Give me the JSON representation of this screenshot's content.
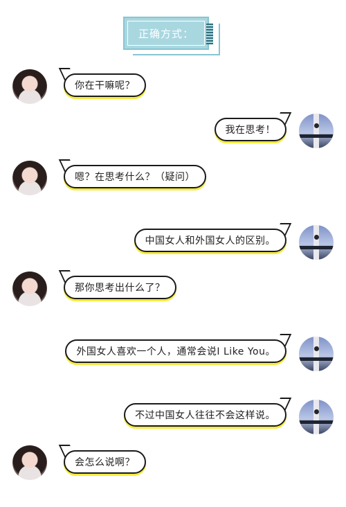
{
  "title": "正确方式：",
  "messages": [
    {
      "side": "left",
      "text": "你在干嘛呢？"
    },
    {
      "side": "right",
      "text": "我在思考！"
    },
    {
      "side": "left",
      "text": "嗯？在思考什么？（疑问）"
    },
    {
      "side": "right",
      "text": "中国女人和外国女人的区别。"
    },
    {
      "side": "left",
      "text": "那你思考出什么了？"
    },
    {
      "side": "right",
      "text": "外国女人喜欢一个人，通常会说I Like You。"
    },
    {
      "side": "right",
      "text": "不过中国女人往往不会这样说。"
    },
    {
      "side": "left",
      "text": "会怎么说啊？"
    }
  ],
  "colors": {
    "title_bg": "#a9d7e0",
    "bubble_underline": "#f4ea3d",
    "bubble_border": "#1a1a1a"
  },
  "icons": {
    "female_avatar": "female-avatar-photo",
    "male_avatar": "male-avatar-photo"
  }
}
